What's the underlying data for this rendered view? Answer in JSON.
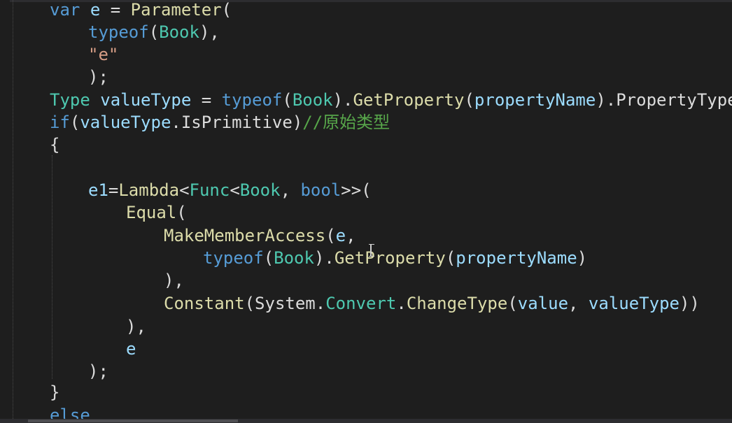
{
  "editor": {
    "lines": [
      {
        "segments": [
          [
            "kw",
            "var"
          ],
          [
            "pl",
            " "
          ],
          [
            "id",
            "e"
          ],
          [
            "pl",
            " = "
          ],
          [
            "fn",
            "Parameter"
          ],
          [
            "pl",
            "("
          ]
        ]
      },
      {
        "segments": [
          [
            "kw",
            "typeof"
          ],
          [
            "pl",
            "("
          ],
          [
            "ty",
            "Book"
          ],
          [
            "pl",
            "),"
          ]
        ]
      },
      {
        "segments": [
          [
            "st",
            "\"e\""
          ]
        ]
      },
      {
        "segments": [
          [
            "pl",
            ");"
          ]
        ]
      },
      {
        "segments": [
          [
            "ty",
            "Type"
          ],
          [
            "pl",
            " "
          ],
          [
            "id",
            "valueType"
          ],
          [
            "pl",
            " = "
          ],
          [
            "kw",
            "typeof"
          ],
          [
            "pl",
            "("
          ],
          [
            "ty",
            "Book"
          ],
          [
            "pl",
            ")."
          ],
          [
            "fn",
            "GetProperty"
          ],
          [
            "pl",
            "("
          ],
          [
            "id",
            "propertyName"
          ],
          [
            "pl",
            ")."
          ],
          [
            "pl",
            "PropertyType;"
          ]
        ]
      },
      {
        "segments": [
          [
            "kw",
            "if"
          ],
          [
            "pl",
            "("
          ],
          [
            "id",
            "valueType"
          ],
          [
            "pl",
            "."
          ],
          [
            "pl",
            "IsPrimitive"
          ],
          [
            "pl",
            ")"
          ],
          [
            "cm",
            "//原始类型"
          ]
        ]
      },
      {
        "segments": [
          [
            "pl",
            "{"
          ]
        ]
      },
      {
        "segments": []
      },
      {
        "segments": [
          [
            "id",
            "e1"
          ],
          [
            "pl",
            "="
          ],
          [
            "fn",
            "Lambda"
          ],
          [
            "pl",
            "<"
          ],
          [
            "ty",
            "Func"
          ],
          [
            "pl",
            "<"
          ],
          [
            "ty",
            "Book"
          ],
          [
            "pl",
            ", "
          ],
          [
            "kw",
            "bool"
          ],
          [
            "pl",
            ">>("
          ]
        ]
      },
      {
        "segments": [
          [
            "fn",
            "Equal"
          ],
          [
            "pl",
            "("
          ]
        ]
      },
      {
        "segments": [
          [
            "fn",
            "MakeMemberAccess"
          ],
          [
            "pl",
            "("
          ],
          [
            "id",
            "e"
          ],
          [
            "pl",
            ","
          ]
        ]
      },
      {
        "segments": [
          [
            "kw",
            "typeof"
          ],
          [
            "pl",
            "("
          ],
          [
            "ty",
            "Book"
          ],
          [
            "pl",
            ")."
          ],
          [
            "fn",
            "GetProperty"
          ],
          [
            "pl",
            "("
          ],
          [
            "id",
            "propertyName"
          ],
          [
            "pl",
            ")"
          ]
        ]
      },
      {
        "segments": [
          [
            "pl",
            "),"
          ]
        ]
      },
      {
        "segments": [
          [
            "fn",
            "Constant"
          ],
          [
            "pl",
            "("
          ],
          [
            "pl",
            "System."
          ],
          [
            "ty",
            "Convert"
          ],
          [
            "pl",
            "."
          ],
          [
            "fn",
            "ChangeType"
          ],
          [
            "pl",
            "("
          ],
          [
            "id",
            "value"
          ],
          [
            "pl",
            ", "
          ],
          [
            "id",
            "valueType"
          ],
          [
            "pl",
            "))"
          ]
        ]
      },
      {
        "segments": [
          [
            "pl",
            "),"
          ]
        ]
      },
      {
        "segments": [
          [
            "id",
            "e"
          ]
        ]
      },
      {
        "segments": [
          [
            "pl",
            ");"
          ]
        ]
      },
      {
        "segments": [
          [
            "pl",
            "}"
          ]
        ]
      },
      {
        "segments": [
          [
            "kw",
            "else"
          ]
        ]
      }
    ]
  },
  "colors": {
    "background": "#1e1e1e",
    "keyword": "#569cd6",
    "type": "#4ec9b0",
    "method": "#dcdcaa",
    "identifier": "#9cdcfe",
    "plain": "#dcdcdc",
    "string": "#d69d85",
    "comment": "#57a64a"
  },
  "icons": {
    "cursor": "text-cursor-icon"
  }
}
